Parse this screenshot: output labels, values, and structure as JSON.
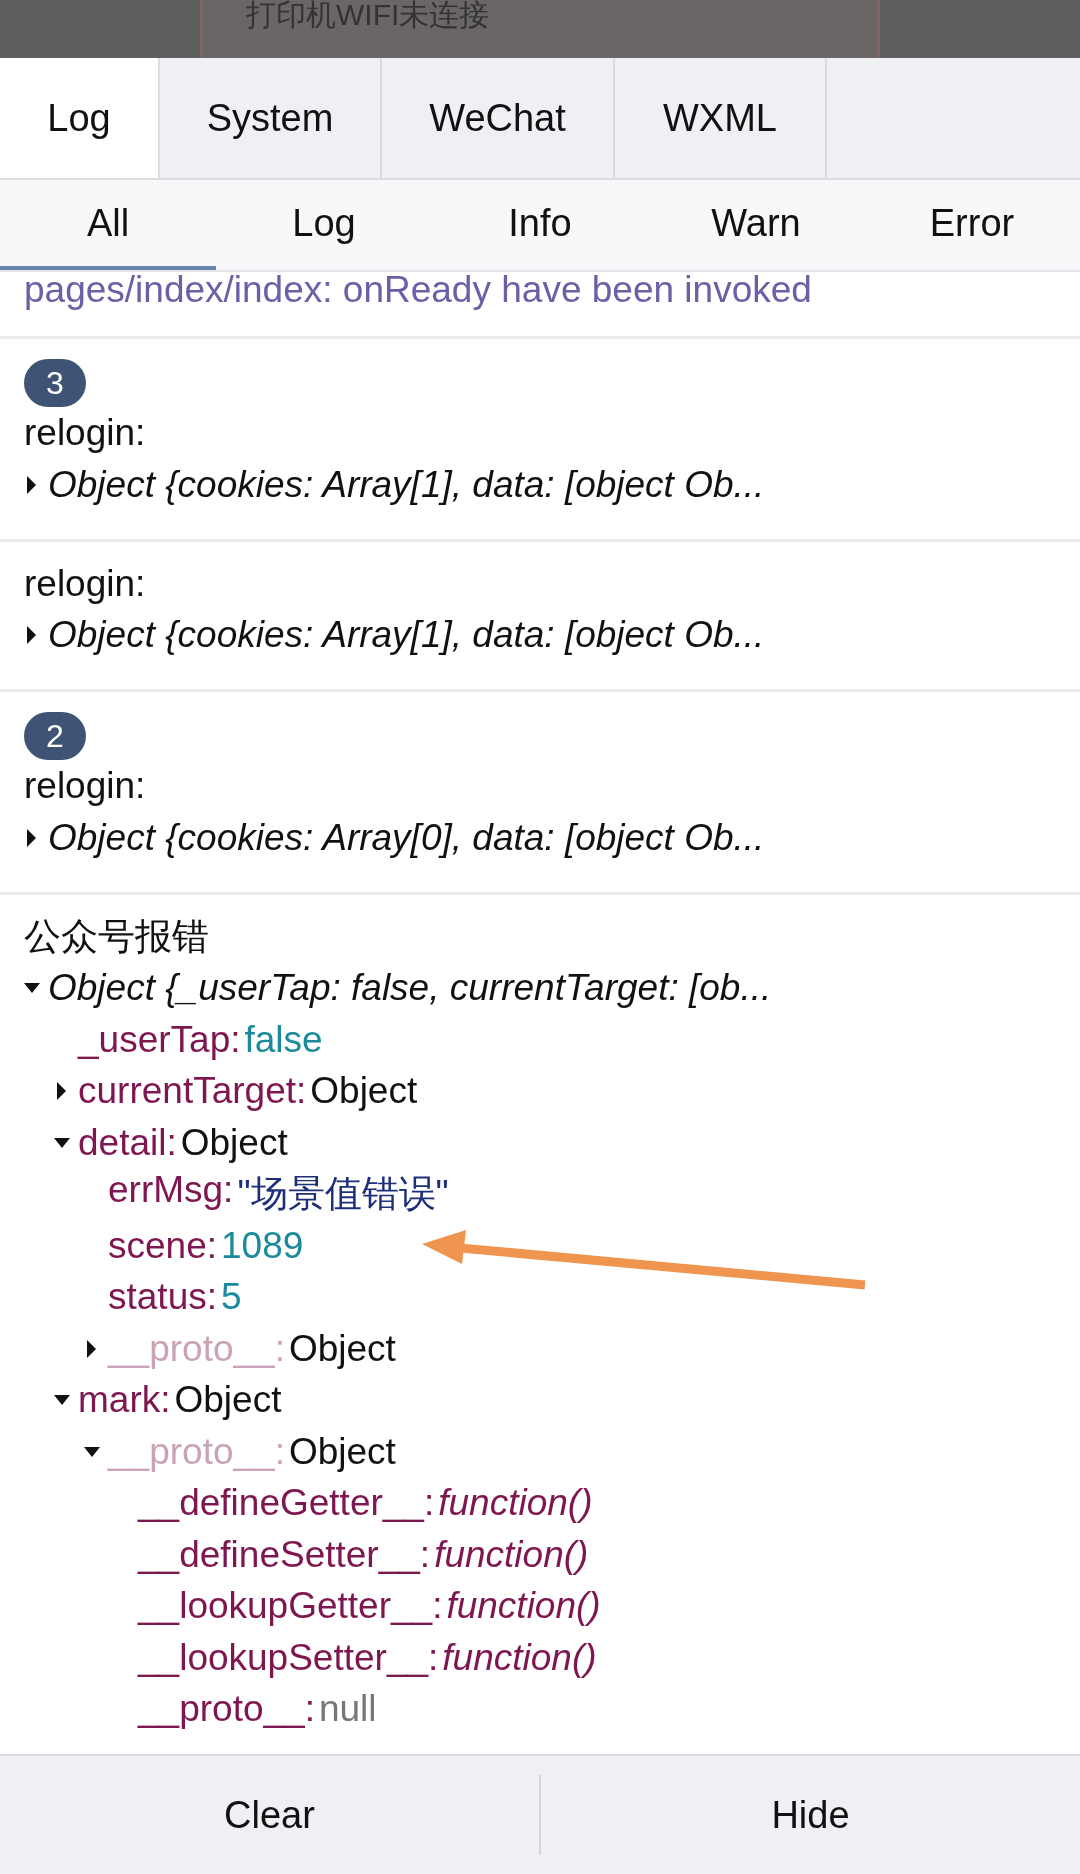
{
  "background": {
    "dialog_text": "打印机WIFI未连接"
  },
  "tabs": [
    {
      "label": "Log",
      "selected": true
    },
    {
      "label": "System",
      "selected": false
    },
    {
      "label": "WeChat",
      "selected": false
    },
    {
      "label": "WXML",
      "selected": false
    }
  ],
  "filters": [
    {
      "label": "All",
      "selected": true
    },
    {
      "label": "Log",
      "selected": false
    },
    {
      "label": "Info",
      "selected": false
    },
    {
      "label": "Warn",
      "selected": false
    },
    {
      "label": "Error",
      "selected": false
    }
  ],
  "log_entries": [
    {
      "kind": "message",
      "text": "pages/index/index: onReady have been invoked"
    },
    {
      "kind": "object",
      "count": "3",
      "title": "relogin:",
      "tree": [
        {
          "text": "Object {cookies: Array[1], data: [object Ob...",
          "kind": "summary",
          "expanded": false
        }
      ]
    },
    {
      "kind": "object",
      "title": "relogin:",
      "tree": [
        {
          "text": "Object {cookies: Array[1], data: [object Ob...",
          "kind": "summary",
          "expanded": false
        }
      ]
    },
    {
      "kind": "object",
      "count": "2",
      "title": "relogin:",
      "tree": [
        {
          "text": "Object {cookies: Array[0], data: [object Ob...",
          "kind": "summary",
          "expanded": false
        }
      ]
    },
    {
      "kind": "object",
      "title": "公众号报错",
      "tree": [
        {
          "text": "Object {_userTap: false, currentTarget: [ob...",
          "kind": "summary",
          "expanded": true,
          "children": [
            {
              "key": "_userTap:",
              "value": "false",
              "kind": "boolean"
            },
            {
              "key": "currentTarget:",
              "value": "Object",
              "kind": "object",
              "expanded": false
            },
            {
              "key": "detail:",
              "value": "Object",
              "kind": "object",
              "expanded": true,
              "children": [
                {
                  "key": "errMsg:",
                  "value": "\"场景值错误\"",
                  "kind": "string"
                },
                {
                  "key": "scene:",
                  "value": "1089",
                  "kind": "number"
                },
                {
                  "key": "status:",
                  "value": "5",
                  "kind": "number"
                },
                {
                  "key": "__proto__:",
                  "value": "Object",
                  "kind": "object",
                  "internal": true,
                  "expanded": false
                }
              ]
            },
            {
              "key": "mark:",
              "value": "Object",
              "kind": "object",
              "expanded": true,
              "children": [
                {
                  "key": "__proto__:",
                  "value": "Object",
                  "kind": "object",
                  "internal": true,
                  "expanded": true,
                  "children": [
                    {
                      "key": "__defineGetter__:",
                      "value": "function()",
                      "kind": "function"
                    },
                    {
                      "key": "__defineSetter__:",
                      "value": "function()",
                      "kind": "function"
                    },
                    {
                      "key": "__lookupGetter__:",
                      "value": "function()",
                      "kind": "function"
                    },
                    {
                      "key": "__lookupSetter__:",
                      "value": "function()",
                      "kind": "function"
                    },
                    {
                      "key": "__proto__:",
                      "value": "null",
                      "kind": "null"
                    }
                  ]
                }
              ]
            }
          ]
        }
      ]
    }
  ],
  "buttons": [
    {
      "label": "Clear"
    },
    {
      "label": "Hide"
    }
  ]
}
